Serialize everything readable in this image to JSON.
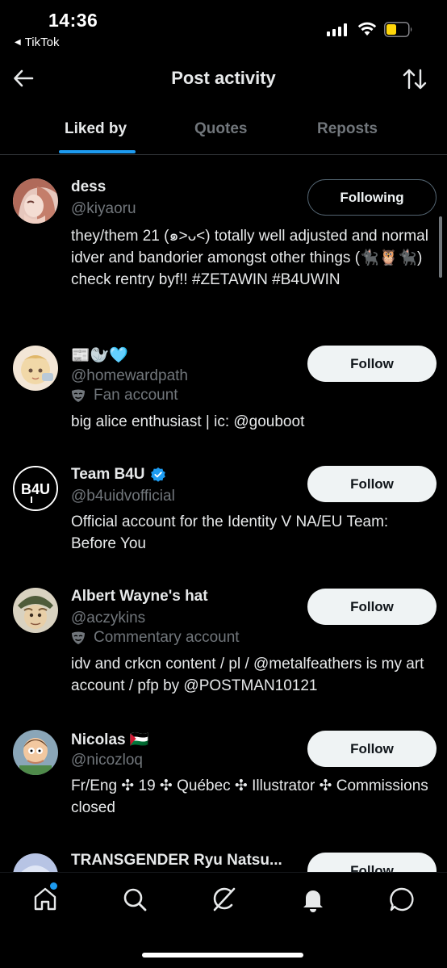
{
  "status_bar": {
    "time": "14:36",
    "back_app": "TikTok",
    "battery_color": "#ffd60a"
  },
  "header": {
    "title": "Post activity",
    "back_icon": "arrow-left-icon",
    "sort_icon": "sort-arrows-icon"
  },
  "tabs": [
    {
      "label": "Liked by",
      "active": true
    },
    {
      "label": "Quotes",
      "active": false
    },
    {
      "label": "Reposts",
      "active": false
    }
  ],
  "accent_color": "#1d9bf0",
  "users": [
    {
      "name": "dess",
      "handle": "@kiyaoru",
      "button": "Following",
      "bio": "they/them 21 (๑˃ᴗ˂) totally well adjusted and normal idver and bandorier amongst other things (🐈‍⬛🦉🐈‍⬛) check rentry byf!! #ZETAWIN #B4UWIN"
    },
    {
      "name": "📰🦭🩵",
      "handle": "@homewardpath",
      "label": "Fan account",
      "label_icon": "mask-icon",
      "button": "Follow",
      "bio": "big alice enthusiast | ic: @gouboot"
    },
    {
      "name": "Team B4U",
      "verified": true,
      "handle": "@b4uidvofficial",
      "button": "Follow",
      "bio": "Official account for the Identity V NA/EU Team: Before You"
    },
    {
      "name": "Albert Wayne's hat",
      "handle": "@aczykins",
      "label": "Commentary account",
      "label_icon": "mask-icon",
      "button": "Follow",
      "bio": "idv and crkcn content / pl / @metalfeathers is my art account / pfp by @POSTMAN10121"
    },
    {
      "name": "Nicolas 🇵🇸",
      "handle": "@nicozloq",
      "button": "Follow",
      "bio": "Fr/Eng ✣ 19 ✣ Québec ✣ Illustrator ✣ Commissions closed"
    },
    {
      "name": "TRANSGENDER Ryu Natsu...",
      "button": "Follow"
    }
  ],
  "bottom_nav": [
    "home-icon",
    "search-icon",
    "grok-icon",
    "notifications-bell-icon",
    "messages-icon"
  ]
}
